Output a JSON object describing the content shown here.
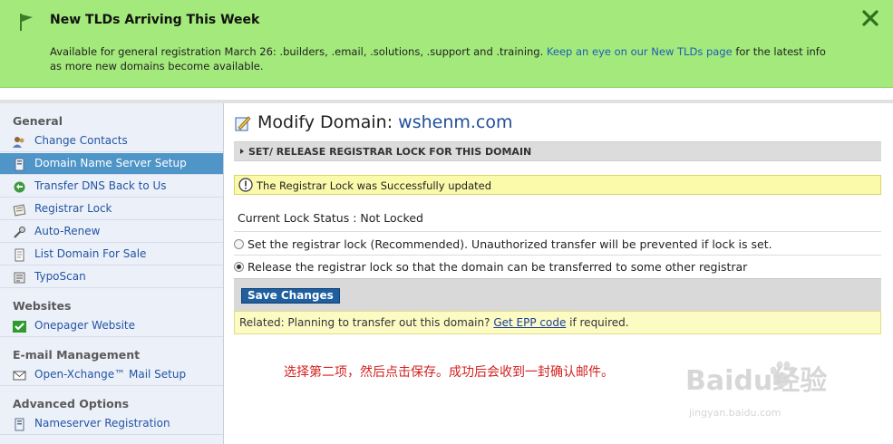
{
  "banner": {
    "title": "New TLDs Arriving This Week",
    "desc_prefix": "Available for general registration March 26: .builders, .email, .solutions, .support and .training. ",
    "link_text": "Keep an eye on our New TLDs page",
    "desc_suffix": " for the latest info as more new domains become available.",
    "close_label": "×",
    "bg_color": "#a3e97b"
  },
  "sidebar": {
    "sections": [
      {
        "title": "General"
      },
      {
        "title": "Websites"
      },
      {
        "title": "E-mail Management"
      },
      {
        "title": "Advanced Options"
      }
    ],
    "items": [
      {
        "label": "Change Contacts",
        "icon": "contacts-icon"
      },
      {
        "label": "Domain Name Server Setup",
        "icon": "server-icon",
        "active": true
      },
      {
        "label": "Transfer DNS Back to Us",
        "icon": "transfer-icon"
      },
      {
        "label": "Registrar Lock",
        "icon": "lock-icon"
      },
      {
        "label": "Auto-Renew",
        "icon": "renew-icon"
      },
      {
        "label": "List Domain For Sale",
        "icon": "sale-icon"
      },
      {
        "label": "TypoScan",
        "icon": "typoscan-icon"
      },
      {
        "label": "Onepager Website",
        "icon": "checkmark-icon"
      },
      {
        "label": "Open-Xchange™ Mail Setup",
        "icon": "mail-icon"
      },
      {
        "label": "Nameserver Registration",
        "icon": "nameserver-icon"
      }
    ],
    "active_color": "#4f95c7"
  },
  "main": {
    "title_prefix": "Modify Domain:",
    "domain": "wshenm.com",
    "section_header": "SET/ RELEASE REGISTRAR LOCK FOR THIS DOMAIN",
    "notice": "The Registrar Lock was Successfully updated",
    "status": "Current Lock Status : Not Locked",
    "options": [
      {
        "label": "Set the registrar lock (Recommended). Unauthorized transfer will be prevented if lock is set.",
        "checked": false
      },
      {
        "label": "Release the registrar lock so that the domain can be transferred to some other registrar",
        "checked": true
      }
    ],
    "save_label": "Save Changes",
    "related_prefix": "Related: Planning to transfer out this domain? ",
    "related_link": "Get EPP code",
    "related_suffix": " if required."
  },
  "annotation": "选择第二项，然后点击保存。成功后会收到一封确认邮件。",
  "watermark": {
    "text": "Baidu经验",
    "url": "jingyan.baidu.com"
  }
}
